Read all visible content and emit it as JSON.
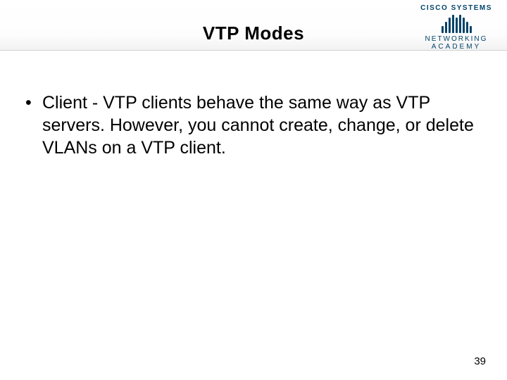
{
  "header": {
    "title": "VTP Modes",
    "logo": {
      "brand": "CISCO SYSTEMS",
      "line1": "NETWORKING",
      "line2": "ACADEMY"
    }
  },
  "content": {
    "bullets": [
      "Client - VTP clients behave the same way as VTP servers. However, you cannot create, change, or delete VLANs on a VTP client."
    ]
  },
  "footer": {
    "page_number": "39"
  }
}
